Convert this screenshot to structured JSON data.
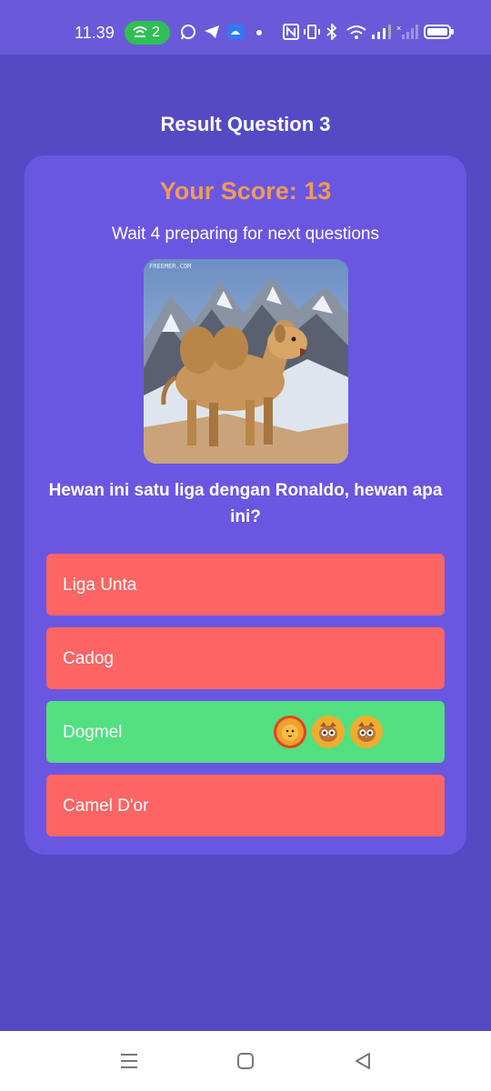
{
  "status_bar": {
    "time": "11.39",
    "badge_count": "2",
    "icons": [
      "whatsapp-icon",
      "telegram-icon",
      "android-icon",
      "dot-icon",
      "nfc-icon",
      "vibrate-icon",
      "bluetooth-icon",
      "wifi-icon",
      "signal-icon",
      "signal-x-icon",
      "battery-icon"
    ]
  },
  "title": "Result Question 3",
  "card": {
    "score_label": "Your Score: 13",
    "wait_text": "Wait 4 preparing for next questions",
    "image_watermark": "FREEMER.COM",
    "question": "Hewan ini satu liga dengan Ronaldo, hewan apa ini?",
    "answers": [
      {
        "label": "Liga Unta",
        "correct": false
      },
      {
        "label": "Cadog",
        "correct": false
      },
      {
        "label": "Dogmel",
        "correct": true,
        "avatars": [
          "lion-avatar",
          "owl-avatar",
          "owl-avatar"
        ]
      },
      {
        "label": "Camel D'or",
        "correct": false
      }
    ]
  },
  "colors": {
    "background": "#5549c4",
    "card": "#6a57e1",
    "score": "#f29b56",
    "wrong": "#ff6565",
    "correct": "#52e080"
  },
  "nav": [
    "menu-icon",
    "home-icon",
    "back-icon"
  ]
}
